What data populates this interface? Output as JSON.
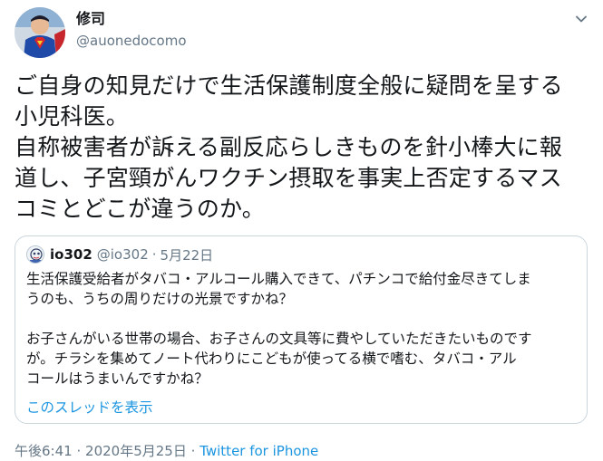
{
  "author": {
    "display_name": "修司",
    "handle": "@auonedocomo"
  },
  "tweet": {
    "text": "ご自身の知見だけで生活保護制度全般に疑問を呈する\n小児科医。\n自称被害者が訴える副反応らしきものを針小棒大に報\n道し、子宮頸がんワクチン摂取を事実上否定するマス\nコミとどこが違うのか。"
  },
  "quoted": {
    "display_name": "io302",
    "handle": "@io302",
    "separator": "·",
    "date": "5月22日",
    "text": "生活保護受給者がタバコ・アルコール購入できて、パチンコで給付金尽きてしま\nうのも、うちの周りだけの光景ですかね？\n\nお子さんがいる世帯の場合、お子さんの文具等に費やしていただきたいものです\nが。チラシを集めてノート代わりにこどもが使ってる横で嗜む、タバコ・アル\nコールはうまいんですかね？",
    "show_thread": "このスレッドを表示"
  },
  "footer": {
    "time": "午後6:41",
    "sep1": "·",
    "date": "2020年5月25日",
    "sep2": "·",
    "source": "Twitter for iPhone"
  },
  "colors": {
    "text": "#14171a",
    "secondary": "#657786",
    "link": "#1b95e0",
    "border": "#ccd6dd"
  },
  "icons": {
    "more": "chevron-down-icon",
    "author_avatar": "avatar",
    "quoted_avatar": "avatar"
  }
}
